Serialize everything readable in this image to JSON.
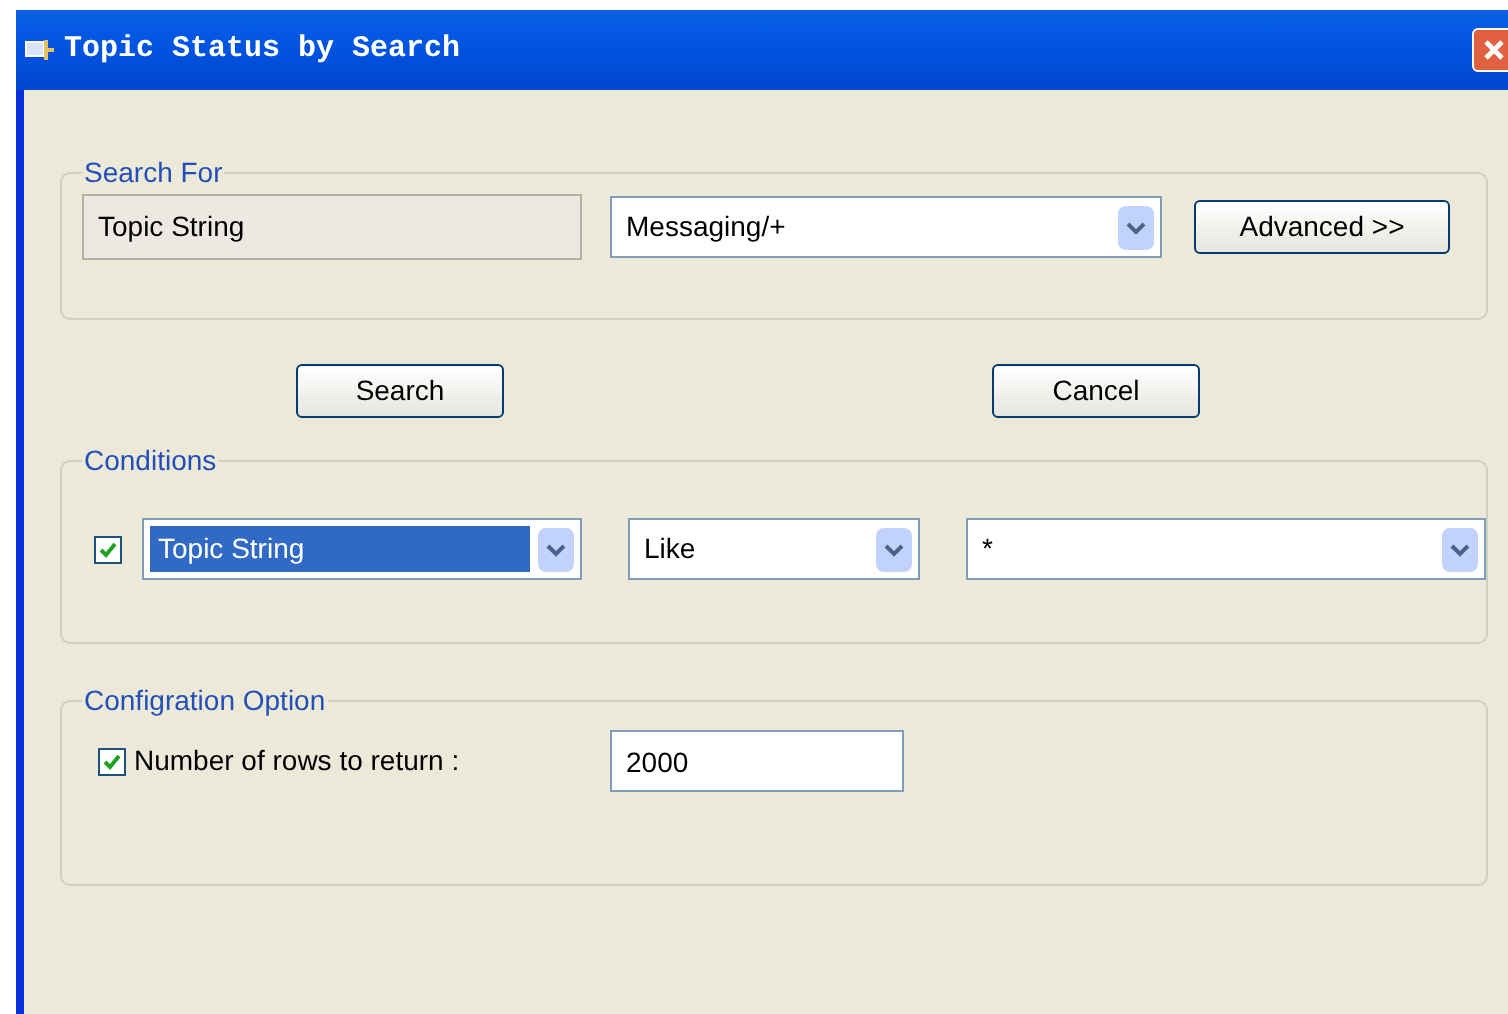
{
  "window": {
    "title": "Topic Status by Search"
  },
  "search_for": {
    "title": "Search For",
    "field_label": "Topic String",
    "topic": "Messaging/+",
    "advanced_button": "Advanced >>"
  },
  "buttons": [
    "Search",
    "Cancel"
  ],
  "conditions": {
    "title": "Conditions",
    "enabled": true,
    "field": {
      "value": "Topic String",
      "selected": true
    },
    "operator": "Like",
    "pattern": "*"
  },
  "configuration": {
    "title": "Configration Option",
    "limit_rows": true,
    "label": "Number of rows to return :",
    "rows": "2000"
  }
}
